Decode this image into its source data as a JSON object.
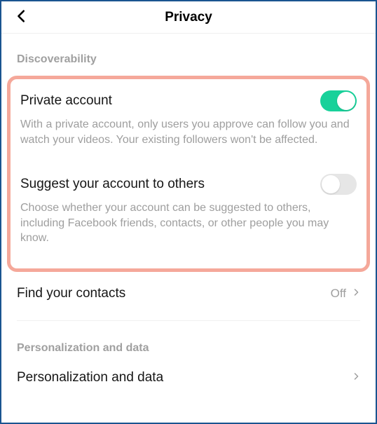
{
  "header": {
    "title": "Privacy"
  },
  "sections": {
    "discoverability": {
      "header": "Discoverability",
      "private_account": {
        "title": "Private account",
        "description": "With a private account, only users you approve can follow you and watch your videos. Your existing followers won't be affected.",
        "enabled": true
      },
      "suggest_account": {
        "title": "Suggest your account to others",
        "description": "Choose whether your account can be suggested to others, including Facebook friends, contacts, or other people you may know.",
        "enabled": false
      },
      "find_contacts": {
        "title": "Find your contacts",
        "value": "Off"
      }
    },
    "personalization": {
      "header": "Personalization and data",
      "row": {
        "title": "Personalization and data"
      }
    }
  },
  "colors": {
    "border": "#1a5490",
    "highlight": "#f5a89a",
    "toggle_on": "#18d19a"
  }
}
